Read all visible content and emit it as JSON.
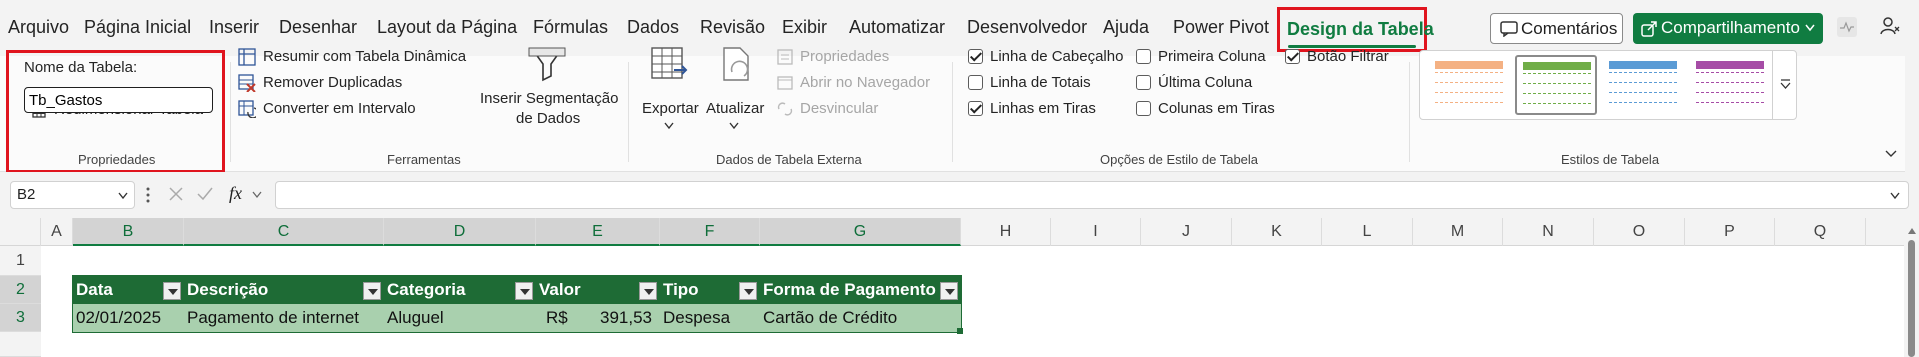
{
  "menu": {
    "items": [
      "Arquivo",
      "Página Inicial",
      "Inserir",
      "Desenhar",
      "Layout da Página",
      "Fórmulas",
      "Dados",
      "Revisão",
      "Exibir",
      "Automatizar",
      "Desenvolvedor",
      "Ajuda",
      "Power Pivot"
    ],
    "active_tab": "Design da Tabela",
    "comments": "Comentários",
    "share": "Compartilhamento"
  },
  "ribbon": {
    "properties": {
      "name_label": "Nome da Tabela:",
      "name_value": "Tb_Gastos",
      "resize": "Redimensionar Tabela",
      "group": "Propriedades"
    },
    "tools": {
      "pivot": "Resumir com Tabela Dinâmica",
      "dupes": "Remover Duplicadas",
      "convert": "Converter em Intervalo",
      "slicer_1": "Inserir Segmentação",
      "slicer_2": "de Dados",
      "group": "Ferramentas"
    },
    "external": {
      "export": "Exportar",
      "refresh": "Atualizar",
      "props": "Propriedades",
      "browser": "Abrir no Navegador",
      "unlink": "Desvincular",
      "group": "Dados de Tabela Externa"
    },
    "style_opts": {
      "header_row": "Linha de Cabeçalho",
      "total_row": "Linha de Totais",
      "banded_rows": "Linhas em Tiras",
      "first_col": "Primeira Coluna",
      "last_col": "Última Coluna",
      "banded_cols": "Colunas em Tiras",
      "filter_btn": "Botão Filtrar",
      "group": "Opções de Estilo de Tabela",
      "checked": {
        "header_row": true,
        "total_row": false,
        "banded_rows": true,
        "first_col": false,
        "last_col": false,
        "banded_cols": false,
        "filter_btn": true
      }
    },
    "styles": {
      "group": "Estilos de Tabela",
      "swatches": [
        "#f4b183",
        "#70ad47",
        "#5b9bd5",
        "#a64ca6"
      ]
    }
  },
  "formula_bar": {
    "cell_ref": "B2",
    "fx": "fx",
    "content": ""
  },
  "grid": {
    "columns": [
      "A",
      "B",
      "C",
      "D",
      "E",
      "F",
      "G",
      "H",
      "I",
      "J",
      "K",
      "L",
      "M",
      "N",
      "O",
      "P",
      "Q"
    ],
    "rows": [
      "1",
      "2",
      "3"
    ],
    "table": {
      "headers": [
        "Data",
        "Descrição",
        "Categoria",
        "Valor",
        "Tipo",
        "Forma de Pagamento"
      ],
      "row": {
        "data": "02/01/2025",
        "descricao": "Pagamento de internet",
        "categoria": "Aluguel",
        "valor_cur": "R$",
        "valor_num": "391,53",
        "tipo": "Despesa",
        "forma": "Cartão de Crédito"
      }
    }
  },
  "colors": {
    "accent": "#107c41",
    "highlight": "#e0141e",
    "table_header": "#1e6b35",
    "table_row": "#a9d0ae"
  }
}
